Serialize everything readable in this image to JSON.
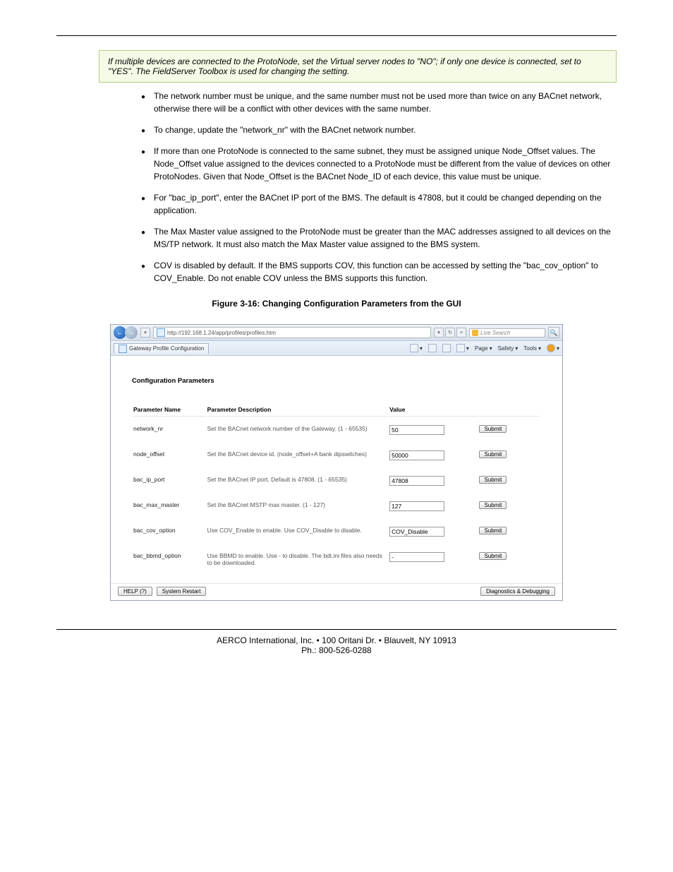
{
  "caution": "If multiple devices are connected to the ProtoNode, set the Virtual server nodes to \"NO\"; if only one device is connected, set to \"YES\". The FieldServer Toolbox is used for changing the setting.",
  "bullets": [
    "The network number must be unique, and the same number must not be used more than twice on any BACnet network, otherwise there will be a conflict with other devices with the same number.",
    "To change, update the \"network_nr\" with the BACnet network number.",
    "If more than one ProtoNode is connected to the same subnet, they must be assigned unique Node_Offset values. The Node_Offset value assigned to the devices connected to a ProtoNode must be different from the value of devices on other ProtoNodes. Given that Node_Offset is the BACnet Node_ID of each device, this value must be unique.",
    "For \"bac_ip_port\", enter the BACnet IP port of the BMS. The default is 47808, but it could be changed depending on the application.",
    "The Max Master value assigned to the ProtoNode must be greater than the MAC addresses assigned to all devices on the MS/TP network. It must also match the Max Master value assigned to the BMS system.",
    "COV is disabled by default. If the BMS supports COV, this function can be accessed by setting the \"bac_cov_option\" to COV_Enable. Do not enable COV unless the BMS supports this function."
  ],
  "figure_caption": "Figure 3-16: Changing Configuration Parameters from the GUI",
  "screenshot": {
    "url": "http://192.168.1.24/app/profiles/profiles.htm",
    "search_placeholder": "Live Search",
    "tab_title": "Gateway Profile Configuration",
    "menu": {
      "page": "Page",
      "safety": "Safety",
      "tools": "Tools"
    },
    "section_title": "Configuration Parameters",
    "headers": {
      "name": "Parameter Name",
      "desc": "Parameter Description",
      "value": "Value"
    },
    "rows": [
      {
        "name": "network_nr",
        "desc": "Set the BACnet network number of the Gateway. (1 - 65535)",
        "value": "50",
        "btn": "Submit"
      },
      {
        "name": "node_offset",
        "desc": "Set the BACnet device id. (node_offset+A bank dipswitches)",
        "value": "50000",
        "btn": "Submit"
      },
      {
        "name": "bac_ip_port",
        "desc": "Set the BACnet IP port. Default is 47808. (1 - 65535)",
        "value": "47808",
        "btn": "Submit"
      },
      {
        "name": "bac_max_master",
        "desc": "Set the BACnet MSTP max master. (1 - 127)",
        "value": "127",
        "btn": "Submit"
      },
      {
        "name": "bac_cov_option",
        "desc": "Use COV_Enable to enable. Use COV_Disable to disable.",
        "value": "COV_Disable",
        "btn": "Submit"
      },
      {
        "name": "bac_bbmd_option",
        "desc": "Use BBMD to enable. Use - to disable. The bdt.ini files also needs to be downloaded.",
        "value": "-",
        "btn": "Submit"
      }
    ],
    "buttons": {
      "help": "HELP (?)",
      "restart": "System Restart",
      "diag": "Diagnostics & Debugging"
    }
  },
  "footer": {
    "line1": "AERCO International, Inc. • 100 Oritani Dr. • Blauvelt, NY 10913",
    "line2": "Ph.: 800-526-0288"
  }
}
